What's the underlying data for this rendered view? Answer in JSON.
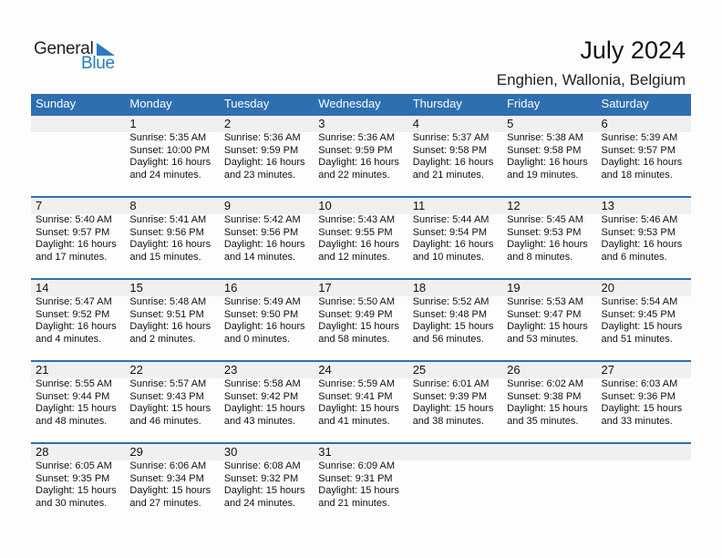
{
  "logo": {
    "text_general": "General",
    "text_blue": "Blue",
    "icon": "triangle-flag-icon"
  },
  "header": {
    "title": "July 2024",
    "location": "Enghien, Wallonia, Belgium"
  },
  "colors": {
    "accent": "#2e6fb0",
    "strip": "#f0f0f0"
  },
  "weekdays": [
    "Sunday",
    "Monday",
    "Tuesday",
    "Wednesday",
    "Thursday",
    "Friday",
    "Saturday"
  ],
  "weeks": [
    [
      null,
      {
        "day": "1",
        "sunrise": "Sunrise: 5:35 AM",
        "sunset": "Sunset: 10:00 PM",
        "daylight1": "Daylight: 16 hours",
        "daylight2": "and 24 minutes."
      },
      {
        "day": "2",
        "sunrise": "Sunrise: 5:36 AM",
        "sunset": "Sunset: 9:59 PM",
        "daylight1": "Daylight: 16 hours",
        "daylight2": "and 23 minutes."
      },
      {
        "day": "3",
        "sunrise": "Sunrise: 5:36 AM",
        "sunset": "Sunset: 9:59 PM",
        "daylight1": "Daylight: 16 hours",
        "daylight2": "and 22 minutes."
      },
      {
        "day": "4",
        "sunrise": "Sunrise: 5:37 AM",
        "sunset": "Sunset: 9:58 PM",
        "daylight1": "Daylight: 16 hours",
        "daylight2": "and 21 minutes."
      },
      {
        "day": "5",
        "sunrise": "Sunrise: 5:38 AM",
        "sunset": "Sunset: 9:58 PM",
        "daylight1": "Daylight: 16 hours",
        "daylight2": "and 19 minutes."
      },
      {
        "day": "6",
        "sunrise": "Sunrise: 5:39 AM",
        "sunset": "Sunset: 9:57 PM",
        "daylight1": "Daylight: 16 hours",
        "daylight2": "and 18 minutes."
      }
    ],
    [
      {
        "day": "7",
        "sunrise": "Sunrise: 5:40 AM",
        "sunset": "Sunset: 9:57 PM",
        "daylight1": "Daylight: 16 hours",
        "daylight2": "and 17 minutes."
      },
      {
        "day": "8",
        "sunrise": "Sunrise: 5:41 AM",
        "sunset": "Sunset: 9:56 PM",
        "daylight1": "Daylight: 16 hours",
        "daylight2": "and 15 minutes."
      },
      {
        "day": "9",
        "sunrise": "Sunrise: 5:42 AM",
        "sunset": "Sunset: 9:56 PM",
        "daylight1": "Daylight: 16 hours",
        "daylight2": "and 14 minutes."
      },
      {
        "day": "10",
        "sunrise": "Sunrise: 5:43 AM",
        "sunset": "Sunset: 9:55 PM",
        "daylight1": "Daylight: 16 hours",
        "daylight2": "and 12 minutes."
      },
      {
        "day": "11",
        "sunrise": "Sunrise: 5:44 AM",
        "sunset": "Sunset: 9:54 PM",
        "daylight1": "Daylight: 16 hours",
        "daylight2": "and 10 minutes."
      },
      {
        "day": "12",
        "sunrise": "Sunrise: 5:45 AM",
        "sunset": "Sunset: 9:53 PM",
        "daylight1": "Daylight: 16 hours",
        "daylight2": "and 8 minutes."
      },
      {
        "day": "13",
        "sunrise": "Sunrise: 5:46 AM",
        "sunset": "Sunset: 9:53 PM",
        "daylight1": "Daylight: 16 hours",
        "daylight2": "and 6 minutes."
      }
    ],
    [
      {
        "day": "14",
        "sunrise": "Sunrise: 5:47 AM",
        "sunset": "Sunset: 9:52 PM",
        "daylight1": "Daylight: 16 hours",
        "daylight2": "and 4 minutes."
      },
      {
        "day": "15",
        "sunrise": "Sunrise: 5:48 AM",
        "sunset": "Sunset: 9:51 PM",
        "daylight1": "Daylight: 16 hours",
        "daylight2": "and 2 minutes."
      },
      {
        "day": "16",
        "sunrise": "Sunrise: 5:49 AM",
        "sunset": "Sunset: 9:50 PM",
        "daylight1": "Daylight: 16 hours",
        "daylight2": "and 0 minutes."
      },
      {
        "day": "17",
        "sunrise": "Sunrise: 5:50 AM",
        "sunset": "Sunset: 9:49 PM",
        "daylight1": "Daylight: 15 hours",
        "daylight2": "and 58 minutes."
      },
      {
        "day": "18",
        "sunrise": "Sunrise: 5:52 AM",
        "sunset": "Sunset: 9:48 PM",
        "daylight1": "Daylight: 15 hours",
        "daylight2": "and 56 minutes."
      },
      {
        "day": "19",
        "sunrise": "Sunrise: 5:53 AM",
        "sunset": "Sunset: 9:47 PM",
        "daylight1": "Daylight: 15 hours",
        "daylight2": "and 53 minutes."
      },
      {
        "day": "20",
        "sunrise": "Sunrise: 5:54 AM",
        "sunset": "Sunset: 9:45 PM",
        "daylight1": "Daylight: 15 hours",
        "daylight2": "and 51 minutes."
      }
    ],
    [
      {
        "day": "21",
        "sunrise": "Sunrise: 5:55 AM",
        "sunset": "Sunset: 9:44 PM",
        "daylight1": "Daylight: 15 hours",
        "daylight2": "and 48 minutes."
      },
      {
        "day": "22",
        "sunrise": "Sunrise: 5:57 AM",
        "sunset": "Sunset: 9:43 PM",
        "daylight1": "Daylight: 15 hours",
        "daylight2": "and 46 minutes."
      },
      {
        "day": "23",
        "sunrise": "Sunrise: 5:58 AM",
        "sunset": "Sunset: 9:42 PM",
        "daylight1": "Daylight: 15 hours",
        "daylight2": "and 43 minutes."
      },
      {
        "day": "24",
        "sunrise": "Sunrise: 5:59 AM",
        "sunset": "Sunset: 9:41 PM",
        "daylight1": "Daylight: 15 hours",
        "daylight2": "and 41 minutes."
      },
      {
        "day": "25",
        "sunrise": "Sunrise: 6:01 AM",
        "sunset": "Sunset: 9:39 PM",
        "daylight1": "Daylight: 15 hours",
        "daylight2": "and 38 minutes."
      },
      {
        "day": "26",
        "sunrise": "Sunrise: 6:02 AM",
        "sunset": "Sunset: 9:38 PM",
        "daylight1": "Daylight: 15 hours",
        "daylight2": "and 35 minutes."
      },
      {
        "day": "27",
        "sunrise": "Sunrise: 6:03 AM",
        "sunset": "Sunset: 9:36 PM",
        "daylight1": "Daylight: 15 hours",
        "daylight2": "and 33 minutes."
      }
    ],
    [
      {
        "day": "28",
        "sunrise": "Sunrise: 6:05 AM",
        "sunset": "Sunset: 9:35 PM",
        "daylight1": "Daylight: 15 hours",
        "daylight2": "and 30 minutes."
      },
      {
        "day": "29",
        "sunrise": "Sunrise: 6:06 AM",
        "sunset": "Sunset: 9:34 PM",
        "daylight1": "Daylight: 15 hours",
        "daylight2": "and 27 minutes."
      },
      {
        "day": "30",
        "sunrise": "Sunrise: 6:08 AM",
        "sunset": "Sunset: 9:32 PM",
        "daylight1": "Daylight: 15 hours",
        "daylight2": "and 24 minutes."
      },
      {
        "day": "31",
        "sunrise": "Sunrise: 6:09 AM",
        "sunset": "Sunset: 9:31 PM",
        "daylight1": "Daylight: 15 hours",
        "daylight2": "and 21 minutes."
      },
      null,
      null,
      null
    ]
  ]
}
